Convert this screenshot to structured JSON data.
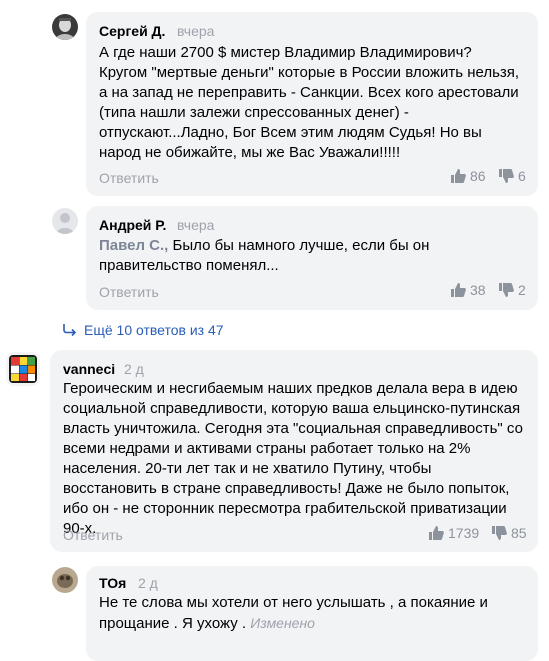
{
  "comments": [
    {
      "author": "Сергей Д.",
      "time": "вчера",
      "text": "А где наши 2700 $ мистер Владимир Владимирович? Кругом \"мертвые деньги\" которые в России вложить нельзя, а на запад не переправить - Санкции. Всех кого арестовали (типа нашли залежи спрессованных денег) - отпускают...Ладно, Бог Всем этим людям Судья! Но вы народ не обижайте, мы же Вас Уважали!!!!!",
      "reply_label": "Ответить",
      "likes": "86",
      "dislikes": "6",
      "avatar_icon": "user-photo-icon"
    },
    {
      "author": "Андрей Р.",
      "time": "вчера",
      "mention": "Павел С.,",
      "text": "Было бы намного лучше, если бы он правительство поменял...",
      "reply_label": "Ответить",
      "likes": "38",
      "dislikes": "2",
      "avatar_icon": "default-avatar-icon"
    },
    {
      "author": "vanneci",
      "time": "2 д",
      "text": "Героическим и несгибаемым наших предков делала вера в идею социальной справедливости, которую ваша ельцинско-путинская власть уничтожила. Сегодня эта \"социальная справедливость\" со всеми недрами и активами страны работает только на 2% населения. 20-ти лет так и не хватило Путину, чтобы восстановить в стране справедливость! Даже не было попыток, ибо он - не сторонник пересмотра грабительской приватизации 90-х.",
      "reply_label": "Ответить",
      "likes": "1739",
      "dislikes": "85",
      "avatar_icon": "rubiks-cube-icon"
    },
    {
      "author": "ТОя",
      "time": "2 д",
      "text": "Не те слова мы хотели от него услышать , а покаяние и прощание . Я ухожу .",
      "edited": "Изменено",
      "avatar_icon": "user-photo-icon"
    }
  ],
  "more_replies": "Ещё 10 ответов из 47",
  "colors": {
    "card_bg": "#f2f3f5",
    "link_blue": "#2a5db6",
    "muted": "#9ea3ab"
  }
}
